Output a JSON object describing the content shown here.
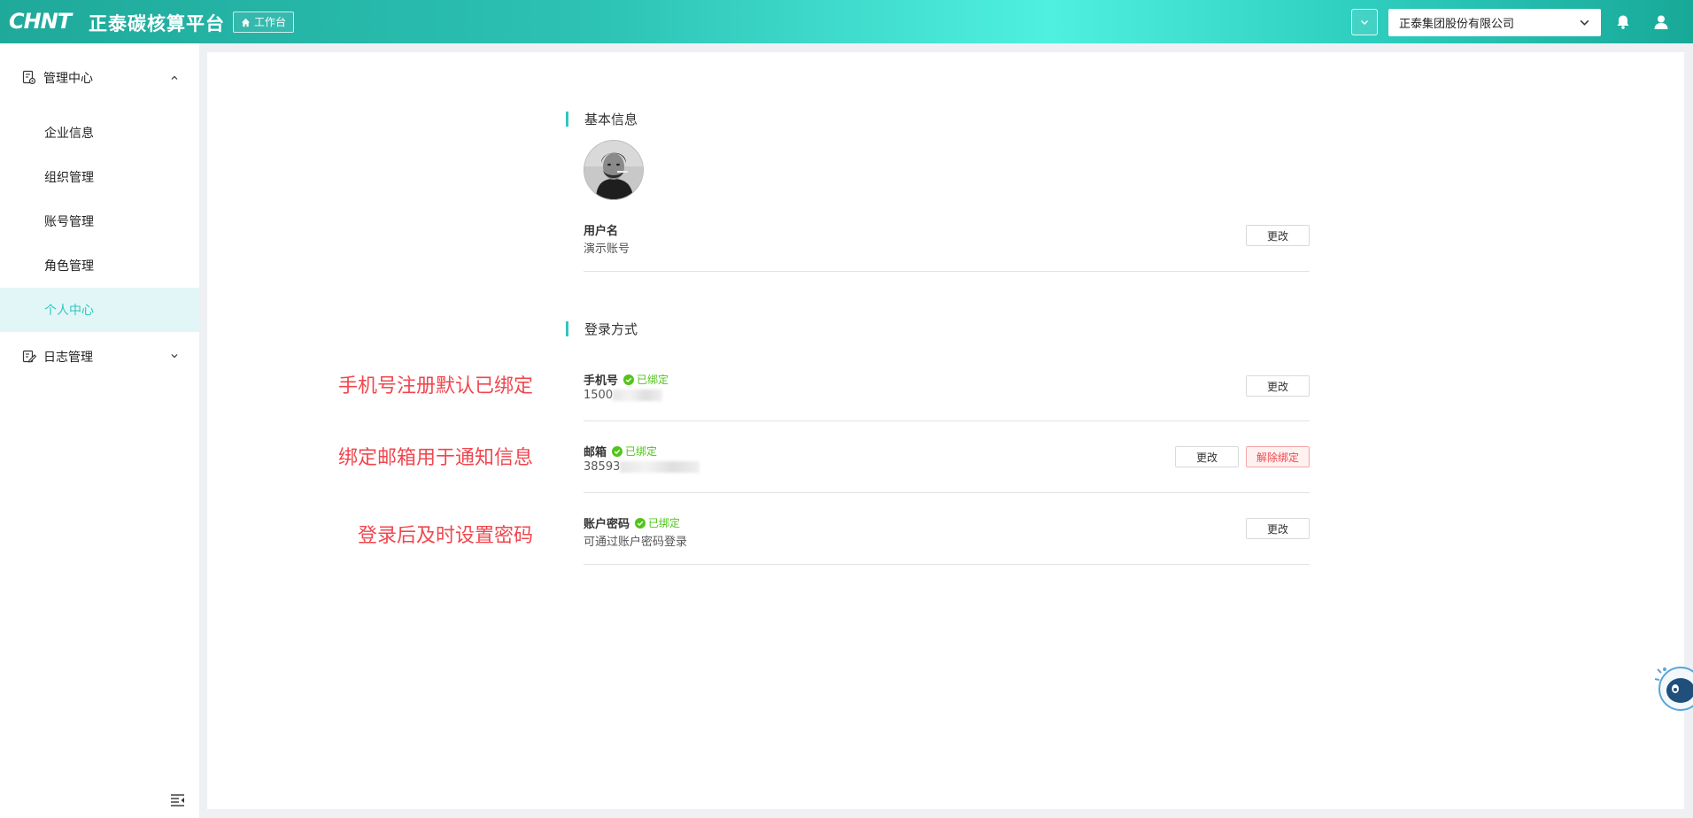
{
  "header": {
    "logo": "CHNT",
    "app_title": "正泰碳核算平台",
    "workbench_label": "工作台",
    "company": "正泰集团股份有限公司"
  },
  "sidebar": {
    "groups": [
      {
        "label": "管理中心",
        "expanded": true,
        "items": [
          {
            "label": "企业信息"
          },
          {
            "label": "组织管理"
          },
          {
            "label": "账号管理"
          },
          {
            "label": "角色管理"
          },
          {
            "label": "个人中心",
            "active": true
          }
        ]
      },
      {
        "label": "日志管理",
        "expanded": false
      }
    ]
  },
  "basic_info": {
    "title": "基本信息",
    "username_label": "用户名",
    "username_value": "演示账号",
    "edit_label": "更改"
  },
  "login_methods": {
    "title": "登录方式",
    "phone": {
      "label": "手机号",
      "status": "已绑定",
      "value": "1500",
      "edit_label": "更改"
    },
    "email": {
      "label": "邮箱",
      "status": "已绑定",
      "value": "38593",
      "edit_label": "更改",
      "unbind_label": "解除绑定"
    },
    "password": {
      "label": "账户密码",
      "status": "已绑定",
      "value": "可通过账户密码登录",
      "edit_label": "更改"
    }
  },
  "annotations": {
    "phone": "手机号注册默认已绑定",
    "email": "绑定邮箱用于通知信息",
    "password": "登录后及时设置密码"
  },
  "colors": {
    "accent": "#2fc7c0",
    "bound_green": "#52c41a",
    "annotation_red": "#f0474e"
  }
}
